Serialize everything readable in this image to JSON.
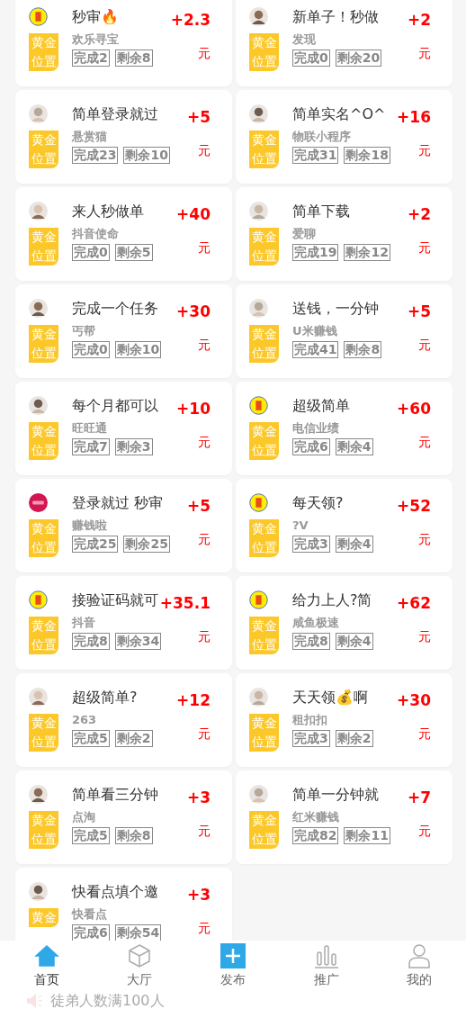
{
  "tasks": [
    {
      "avatar": {
        "kind": "logo"
      },
      "title": "秒审🔥",
      "app": "欢乐寻宝",
      "done": "完成2",
      "remain": "剩余8",
      "price": "+2.3",
      "unit": "元",
      "badge": "黄金位置"
    },
    {
      "avatar": {
        "kind": "photo"
      },
      "title": "新单子！秒做",
      "app": "发现",
      "done": "完成0",
      "remain": "剩余20",
      "price": "+2",
      "unit": "元",
      "badge": "黄金位置"
    },
    {
      "avatar": {
        "kind": "photo"
      },
      "title": "简单登录就过",
      "app": "悬赏猫",
      "done": "完成23",
      "remain": "剩余10",
      "price": "+5",
      "unit": "元",
      "badge": "黄金位置"
    },
    {
      "avatar": {
        "kind": "photo"
      },
      "title": "简单实名^O^",
      "app": "物联小程序",
      "done": "完成31",
      "remain": "剩余18",
      "price": "+16",
      "unit": "元",
      "badge": "黄金位置"
    },
    {
      "avatar": {
        "kind": "photo"
      },
      "title": "来人秒做单",
      "app": "抖音使命",
      "done": "完成0",
      "remain": "剩余5",
      "price": "+40",
      "unit": "元",
      "badge": "黄金位置"
    },
    {
      "avatar": {
        "kind": "photo"
      },
      "title": "简单下载",
      "app": "爱聊",
      "done": "完成19",
      "remain": "剩余12",
      "price": "+2",
      "unit": "元",
      "badge": "黄金位置"
    },
    {
      "avatar": {
        "kind": "photo"
      },
      "title": "完成一个任务",
      "app": "丐帮",
      "done": "完成0",
      "remain": "剩余10",
      "price": "+30",
      "unit": "元",
      "badge": "黄金位置"
    },
    {
      "avatar": {
        "kind": "photo"
      },
      "title": "送钱，一分钟",
      "app": "U米赚钱",
      "done": "完成41",
      "remain": "剩余8",
      "price": "+5",
      "unit": "元",
      "badge": "黄金位置"
    },
    {
      "avatar": {
        "kind": "photo"
      },
      "title": "每个月都可以",
      "app": "旺旺通",
      "done": "完成7",
      "remain": "剩余3",
      "price": "+10",
      "unit": "元",
      "badge": "黄金位置"
    },
    {
      "avatar": {
        "kind": "logo"
      },
      "title": "超级简单",
      "app": "电信业绩",
      "done": "完成6",
      "remain": "剩余4",
      "price": "+60",
      "unit": "元",
      "badge": "黄金位置"
    },
    {
      "avatar": {
        "kind": "brand"
      },
      "title": "登录就过 秒审",
      "app": "赚钱啦",
      "done": "完成25",
      "remain": "剩余25",
      "price": "+5",
      "unit": "元",
      "badge": "黄金位置"
    },
    {
      "avatar": {
        "kind": "logo"
      },
      "title": "每天领?",
      "app": "?V",
      "done": "完成3",
      "remain": "剩余4",
      "price": "+52",
      "unit": "元",
      "badge": "黄金位置"
    },
    {
      "avatar": {
        "kind": "logo"
      },
      "title": "接验证码就可",
      "app": "抖音",
      "done": "完成8",
      "remain": "剩余34",
      "price": "+35.1",
      "unit": "元",
      "badge": "黄金位置"
    },
    {
      "avatar": {
        "kind": "logo"
      },
      "title": "给力上人?简",
      "app": "咸鱼极速",
      "done": "完成8",
      "remain": "剩余4",
      "price": "+62",
      "unit": "元",
      "badge": "黄金位置"
    },
    {
      "avatar": {
        "kind": "photo"
      },
      "title": "超级简单?",
      "app": "263",
      "done": "完成5",
      "remain": "剩余2",
      "price": "+12",
      "unit": "元",
      "badge": "黄金位置"
    },
    {
      "avatar": {
        "kind": "photo"
      },
      "title": "天天领💰啊",
      "app": "租扣扣",
      "done": "完成3",
      "remain": "剩余2",
      "price": "+30",
      "unit": "元",
      "badge": "黄金位置"
    },
    {
      "avatar": {
        "kind": "photo"
      },
      "title": "简单看三分钟",
      "app": "点淘",
      "done": "完成5",
      "remain": "剩余8",
      "price": "+3",
      "unit": "元",
      "badge": "黄金位置"
    },
    {
      "avatar": {
        "kind": "photo"
      },
      "title": "简单一分钟就",
      "app": "红米赚钱",
      "done": "完成82",
      "remain": "剩余11",
      "price": "+7",
      "unit": "元",
      "badge": "黄金位置"
    },
    {
      "avatar": {
        "kind": "photo"
      },
      "title": "快看点填个邀",
      "app": "快看点",
      "done": "完成6",
      "remain": "剩余54",
      "price": "+3",
      "unit": "元",
      "badge": "黄金"
    }
  ],
  "tab_bar": [
    {
      "label": "首页",
      "selected": true
    },
    {
      "label": "大厅",
      "selected": false
    },
    {
      "label": "发布",
      "selected": false
    },
    {
      "label": "推广",
      "selected": false
    },
    {
      "label": "我的",
      "selected": false
    }
  ],
  "notice": {
    "text": "徒弟人数满100人"
  }
}
